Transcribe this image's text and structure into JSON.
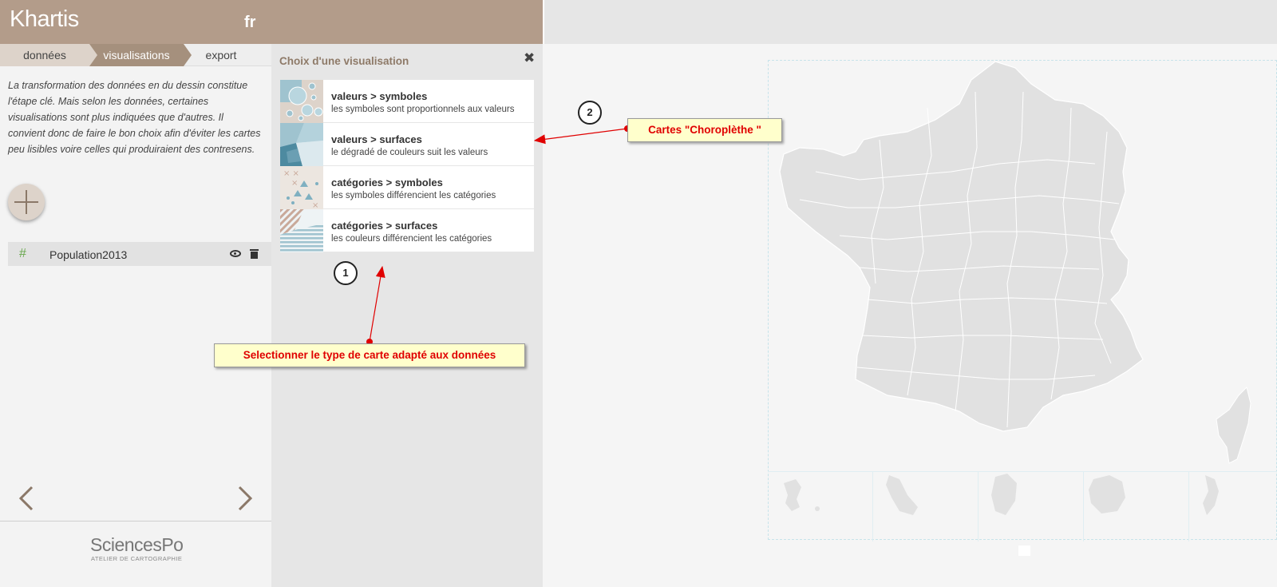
{
  "header": {
    "logo": "Khartis",
    "lang": "fr"
  },
  "steps": [
    "données",
    "visualisations",
    "export"
  ],
  "intro": "La transformation des données en du dessin constitue l'étape clé. Mais selon les données, certaines visualisations sont plus indiquées que d'autres. Il convient donc de faire le bon choix afin d'éviter les cartes peu lisibles voire celles qui produiraient des contresens.",
  "variable": {
    "name": "Population2013",
    "type_symbol": "#"
  },
  "footer": {
    "logo": "SciencesPo",
    "sub": "ATELIER DE CARTOGRAPHIE"
  },
  "panel": {
    "title": "Choix d'une visualisation",
    "close": "✖"
  },
  "visualisations": [
    {
      "title": "valeurs > symboles",
      "desc": "les symboles sont proportionnels aux valeurs",
      "icon": "symbols-proportional-icon"
    },
    {
      "title": "valeurs > surfaces",
      "desc": "le dégradé de couleurs suit les valeurs",
      "icon": "gradient-surfaces-icon"
    },
    {
      "title": "catégories > symboles",
      "desc": "les symboles différencient les catégories",
      "icon": "category-symbols-icon"
    },
    {
      "title": "catégories > surfaces",
      "desc": "les couleurs différencient les catégories",
      "icon": "category-surfaces-icon"
    }
  ],
  "annotations": {
    "c1": "1",
    "c2": "2",
    "box1": "Selectionner le type de carte adapté aux données",
    "box2": "Cartes \"Choroplèthe \""
  },
  "colors": {
    "header": "#b39c8a",
    "accent": "#a5907d",
    "annotation_text": "#e00000",
    "map_fill": "#e1e1e1"
  }
}
